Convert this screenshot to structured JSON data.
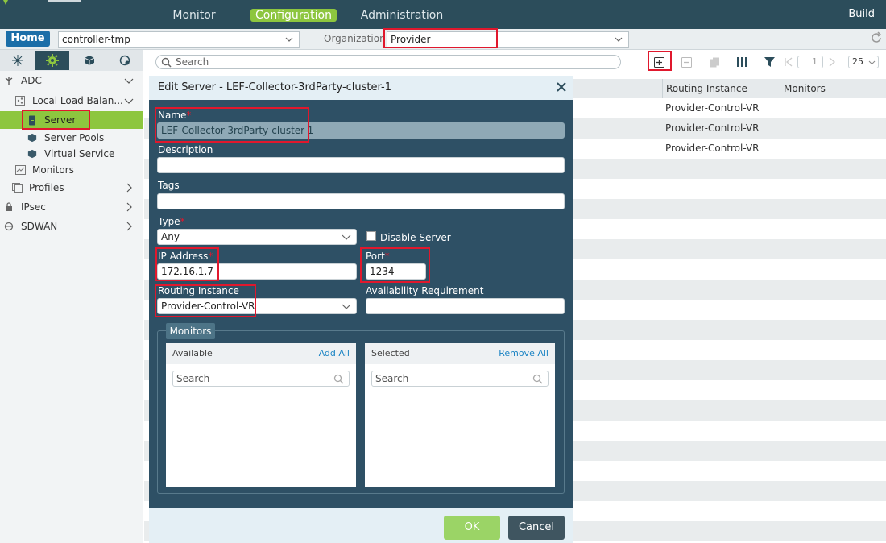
{
  "topnav": {
    "items": [
      {
        "label": "Monitor"
      },
      {
        "label": "Configuration"
      },
      {
        "label": "Administration"
      }
    ],
    "build_label": "Build",
    "colors": {
      "bar": "#2c4d5b",
      "active": "#8dc63f"
    }
  },
  "context": {
    "home_label": "Home",
    "controller_value": "controller-tmp",
    "org_label": "Organization:",
    "org_value": "Provider"
  },
  "sidebar": {
    "tabs": [
      {
        "icon": "network-icon"
      },
      {
        "icon": "gear-icon"
      },
      {
        "icon": "cube-icon"
      },
      {
        "icon": "globe-settings-icon"
      }
    ],
    "tree": [
      {
        "label": "ADC",
        "icon": "adc-icon"
      },
      {
        "label": "Local Load Balan...",
        "icon": "share-icon"
      },
      {
        "label": "Server",
        "icon": "server-icon"
      },
      {
        "label": "Server Pools",
        "icon": "cube-icon"
      },
      {
        "label": "Virtual Service",
        "icon": "cube-icon"
      },
      {
        "label": "Monitors",
        "icon": "chart-icon"
      },
      {
        "label": "Profiles",
        "icon": "profile-icon"
      },
      {
        "label": "IPsec",
        "icon": "lock-icon"
      },
      {
        "label": "SDWAN",
        "icon": "sdwan-icon"
      }
    ]
  },
  "grid": {
    "search_placeholder": "Search",
    "page_value": "1",
    "page_size": "25",
    "columns": [
      "Routing Instance",
      "Monitors"
    ],
    "rows": [
      [
        "Provider-Control-VR",
        ""
      ],
      [
        "Provider-Control-VR",
        ""
      ],
      [
        "Provider-Control-VR",
        ""
      ]
    ]
  },
  "modal": {
    "title": "Edit Server - LEF-Collector-3rdParty-cluster-1",
    "name_label": "Name",
    "name_value": "LEF-Collector-3rdParty-cluster-1",
    "description_label": "Description",
    "description_value": "",
    "tags_label": "Tags",
    "tags_value": "",
    "type_label": "Type",
    "type_value": "Any",
    "disable_label": "Disable Server",
    "ip_label": "IP Address",
    "ip_value": "172.16.1.7",
    "port_label": "Port",
    "port_value": "1234",
    "ri_label": "Routing Instance",
    "ri_value": "Provider-Control-VR",
    "avail_label": "Availability Requirement",
    "avail_value": "",
    "monitors": {
      "legend": "Monitors",
      "available_label": "Available",
      "add_all": "Add All",
      "selected_label": "Selected",
      "remove_all": "Remove All",
      "search_placeholder": "Search"
    },
    "ok_label": "OK",
    "cancel_label": "Cancel"
  }
}
